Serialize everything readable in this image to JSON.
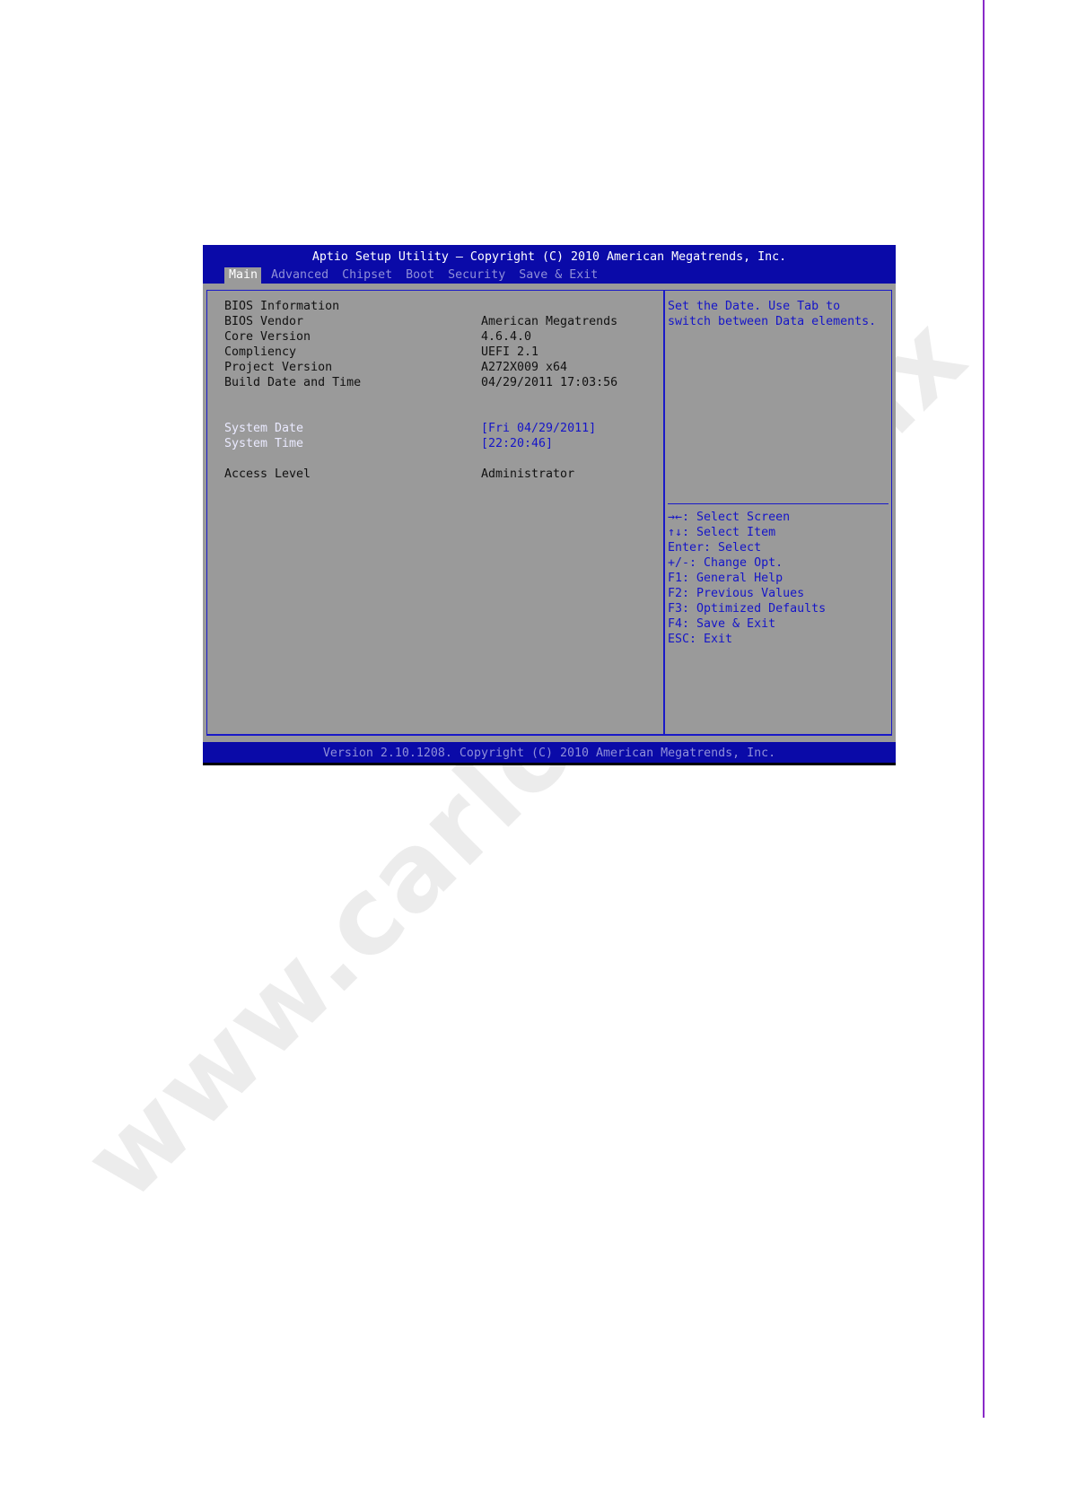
{
  "watermark": "www.carlosmen.mx",
  "bios": {
    "title": "Aptio Setup Utility – Copyright (C) 2010 American Megatrends, Inc.",
    "tabs": [
      {
        "label": "Main",
        "active": true
      },
      {
        "label": "Advanced",
        "active": false
      },
      {
        "label": "Chipset",
        "active": false
      },
      {
        "label": "Boot",
        "active": false
      },
      {
        "label": "Security",
        "active": false
      },
      {
        "label": "Save & Exit",
        "active": false
      }
    ],
    "main": {
      "info_heading": "BIOS Information",
      "rows": [
        {
          "label": "BIOS Vendor",
          "value": "American Megatrends"
        },
        {
          "label": "Core Version",
          "value": "4.6.4.0"
        },
        {
          "label": "Compliency",
          "value": "UEFI 2.1"
        },
        {
          "label": "Project Version",
          "value": "A272X009 x64"
        },
        {
          "label": "Build Date and Time",
          "value": "04/29/2011 17:03:56"
        }
      ],
      "system_date": {
        "label": "System Date",
        "value": "[Fri 04/29/2011]"
      },
      "system_time": {
        "label": "System Time",
        "value": "[22:20:46]"
      },
      "access_level": {
        "label": "Access Level",
        "value": "Administrator"
      }
    },
    "help": {
      "lines": [
        "Set the Date. Use Tab to",
        "switch between Data elements."
      ],
      "keys": [
        "→←: Select Screen",
        "↑↓: Select Item",
        "Enter: Select",
        "+/-: Change Opt.",
        "F1: General Help",
        "F2: Previous Values",
        "F3: Optimized Defaults",
        "F4: Save & Exit",
        "ESC: Exit"
      ]
    },
    "footer": "Version 2.10.1208. Copyright (C) 2010 American Megatrends, Inc."
  },
  "colors": {
    "frame_blue": "#0a0aa8",
    "panel_gray": "#9a9a9a",
    "help_text_blue": "#1515c8",
    "margin_rule_purple": "#8a2bc8"
  }
}
